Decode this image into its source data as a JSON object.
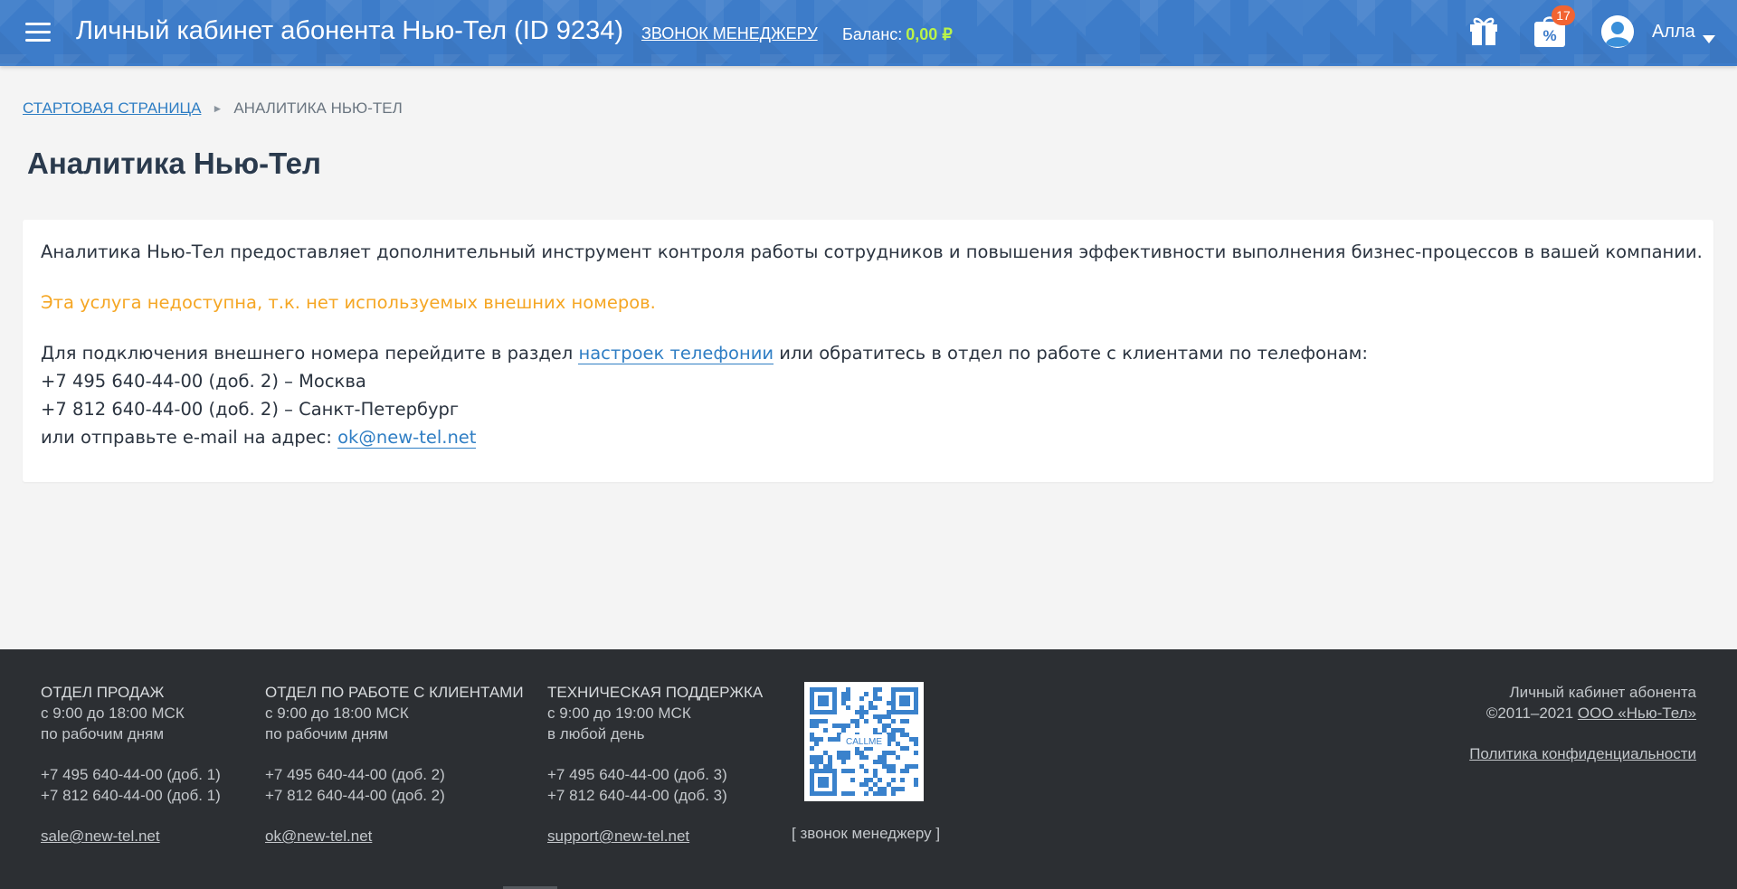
{
  "header": {
    "title": "Личный кабинет абонента Нью-Тел (ID 9234)",
    "call_manager": "ЗВОНОК МЕНЕДЖЕРУ",
    "balance_label": "Баланс:",
    "balance_value": "0,00 ₽",
    "promo_badge": "17",
    "promo_symbol": "%",
    "user_name": "Алла",
    "colors": {
      "bar": "#3d7cc9",
      "balance": "#b9f34a",
      "badge": "#f26432"
    },
    "icons": [
      "menu-icon",
      "gift-icon",
      "promo-icon",
      "user-avatar-icon",
      "chevron-down-icon"
    ]
  },
  "breadcrumb": {
    "home": "СТАРТОВАЯ СТРАНИЦА",
    "separator": "►",
    "current": "АНАЛИТИКА НЬЮ-ТЕЛ"
  },
  "page": {
    "title": "Аналитика Нью-Тел"
  },
  "card": {
    "intro": "Аналитика Нью-Тел предоставляет дополнительный инструмент контроля работы сотрудников и повышения эффективности выполнения бизнес-процессов в вашей компании.",
    "warning": "Эта услуга недоступна, т.к. нет используемых внешних номеров.",
    "connect_prefix": "Для подключения внешнего номера перейдите в раздел ",
    "connect_link": "настроек телефонии",
    "connect_suffix": " или обратитесь в отдел по работе с клиентами по телефонам:",
    "phone_msk": "+7 495 640-44-00  (доб. 2) – Москва",
    "phone_spb": "+7 812 640-44-00  (доб. 2) – Санкт-Петербург",
    "email_prefix": "или отправьте e-mail на адрес: ",
    "email_link": "ok@new-tel.net",
    "colors": {
      "link": "#2f7ec4",
      "warning": "#f5a623"
    }
  },
  "footer": {
    "sales": {
      "title": "ОТДЕЛ ПРОДАЖ",
      "hours": "с 9:00 до 18:00 МСК",
      "days": "по рабочим дням",
      "phone1": "+7 495 640-44-00  (доб. 1)",
      "phone2": "+7 812 640-44-00  (доб. 1)",
      "email": "sale@new-tel.net"
    },
    "clients": {
      "title": "ОТДЕЛ ПО РАБОТЕ С КЛИЕНТАМИ",
      "hours": "с 9:00 до 18:00 МСК",
      "days": "по рабочим дням",
      "phone1": "+7 495 640-44-00  (доб. 2)",
      "phone2": "+7 812 640-44-00  (доб. 2)",
      "email": "ok@new-tel.net"
    },
    "support": {
      "title": "ТЕХНИЧЕСКАЯ ПОДДЕРЖКА",
      "hours": "с 9:00 до 19:00 МСК",
      "days": "в любой день",
      "phone1": "+7 495 640-44-00  (доб. 3)",
      "phone2": "+7 812 640-44-00  (доб. 3)",
      "email": "support@new-tel.net"
    },
    "qr_center_text": "CALLME",
    "qr_caption": "[ звонок менеджеру ]",
    "cabinet": "Личный кабинет абонента",
    "copyright": "©2011–2021 ",
    "owner": "ООО «Нью-Тел»",
    "policy": "Политика конфиденциальности",
    "colors": {
      "background": "#2c2f33",
      "qr": "#3a82cc"
    }
  }
}
